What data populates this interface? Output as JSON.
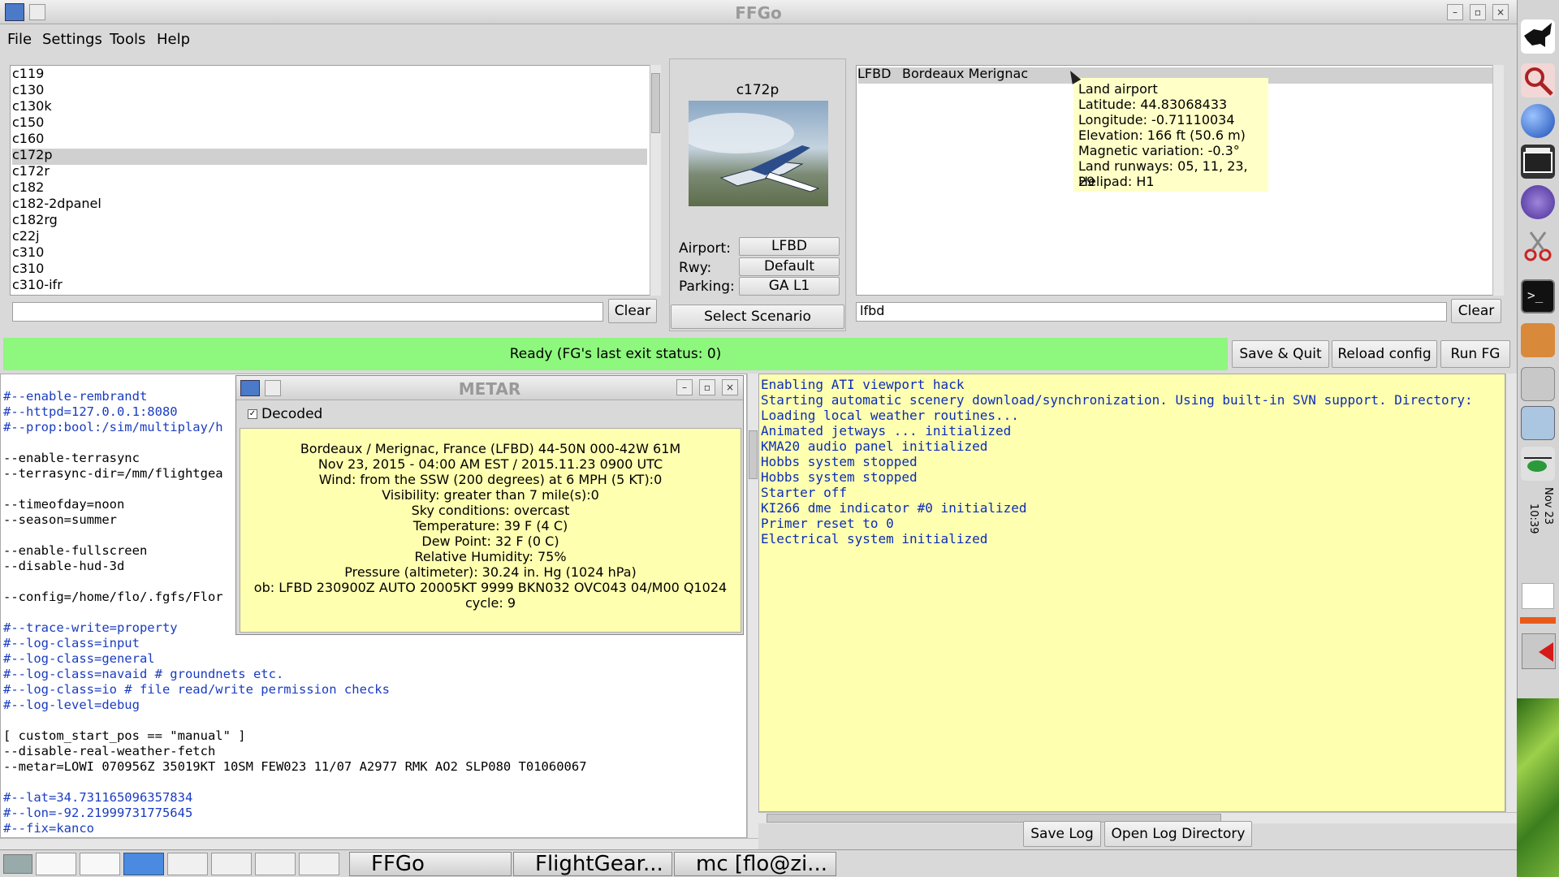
{
  "window": {
    "title": "FFGo"
  },
  "menu": [
    "File",
    "Settings",
    "Tools",
    "Help"
  ],
  "aircraft_list": {
    "items": [
      "c119",
      "c130",
      "c130k",
      "c150",
      "c160",
      "c172p",
      "c172r",
      "c182",
      "c182-2dpanel",
      "c182rg",
      "c22j",
      "c310",
      "c310",
      "c310-ifr"
    ],
    "selected": "c172p",
    "filter_value": "",
    "clear_label": "Clear"
  },
  "aircraft_info": {
    "name": "c172p",
    "airport_label": "Airport:",
    "airport_value": "LFBD",
    "rwy_label": "Rwy:",
    "rwy_value": "Default",
    "parking_label": "Parking:",
    "parking_value": "GA L1",
    "scenario_button": "Select Scenario"
  },
  "airport_list": {
    "items": [
      {
        "icao": "LFBD",
        "name": "Bordeaux Merignac"
      }
    ],
    "filter_value": "lfbd",
    "clear_label": "Clear"
  },
  "tooltip": {
    "lines": [
      "Land airport",
      "Latitude: 44.83068433",
      "Longitude: -0.71110034",
      "Elevation: 166 ft (50.6 m)",
      "Magnetic variation: -0.3°",
      "Land runways: 05, 11, 23, 29",
      "Helipad: H1"
    ]
  },
  "status": {
    "text": "Ready (FG's last exit status: 0)",
    "color": "#8ef77e"
  },
  "actions": {
    "save_quit": "Save & Quit",
    "reload_config": "Reload config",
    "run_fg": "Run FG"
  },
  "config_lines": [
    {
      "t": "#--enable-rembrandt",
      "c": "blue"
    },
    {
      "t": "#--httpd=127.0.0.1:8080",
      "c": "blue"
    },
    {
      "t": "#--prop:bool:/sim/multiplay/h",
      "c": "blue"
    },
    {
      "t": "",
      "c": ""
    },
    {
      "t": "--enable-terrasync",
      "c": ""
    },
    {
      "t": "--terrasync-dir=/mm/flightgea",
      "c": ""
    },
    {
      "t": "",
      "c": ""
    },
    {
      "t": "--timeofday=noon",
      "c": ""
    },
    {
      "t": "--season=summer",
      "c": ""
    },
    {
      "t": "",
      "c": ""
    },
    {
      "t": "--enable-fullscreen",
      "c": ""
    },
    {
      "t": "--disable-hud-3d",
      "c": ""
    },
    {
      "t": "",
      "c": ""
    },
    {
      "t": "--config=/home/flo/.fgfs/Flor",
      "c": ""
    },
    {
      "t": "",
      "c": ""
    },
    {
      "t": "#--trace-write=property",
      "c": "blue"
    },
    {
      "t": "#--log-class=input",
      "c": "blue"
    },
    {
      "t": "#--log-class=general",
      "c": "blue"
    },
    {
      "t": "#--log-class=navaid # groundnets etc.",
      "c": "blue"
    },
    {
      "t": "#--log-class=io # file read/write permission checks",
      "c": "blue"
    },
    {
      "t": "#--log-level=debug",
      "c": "blue"
    },
    {
      "t": "",
      "c": ""
    },
    {
      "t": "[ custom_start_pos == \"manual\" ]",
      "c": ""
    },
    {
      "t": "--disable-real-weather-fetch",
      "c": ""
    },
    {
      "t": "--metar=LOWI 070956Z 35019KT 10SM FEW023 11/07 A2977 RMK AO2 SLP080 T01060067",
      "c": ""
    },
    {
      "t": "",
      "c": ""
    },
    {
      "t": "#--lat=34.731165096357834",
      "c": "blue"
    },
    {
      "t": "#--lon=-92.21999731775645",
      "c": "blue"
    },
    {
      "t": "#--fix=kanco",
      "c": "blue"
    }
  ],
  "log_lines": [
    "Enabling ATI viewport hack",
    "Starting automatic scenery download/synchronization. Using built-in SVN support. Directory:",
    "Loading local weather routines...",
    "Animated jetways ... initialized",
    "KMA20 audio panel initialized",
    "Hobbs system stopped",
    "Hobbs system stopped",
    "Starter off",
    "KI266 dme indicator #0 initialized",
    "Primer reset to 0",
    "Electrical system initialized"
  ],
  "log_buttons": {
    "save_log": "Save Log",
    "open_dir": "Open Log Directory"
  },
  "metar": {
    "title": "METAR",
    "decoded_label": "Decoded",
    "decoded_checked": true,
    "lines": [
      "Bordeaux / Merignac, France (LFBD) 44-50N 000-42W 61M",
      "Nov 23, 2015 - 04:00 AM EST / 2015.11.23 0900 UTC",
      "Wind: from the SSW (200 degrees) at 6 MPH (5 KT):0",
      "Visibility: greater than 7 mile(s):0",
      "Sky conditions: overcast",
      "Temperature: 39 F (4 C)",
      "Dew Point: 32 F (0 C)",
      "Relative Humidity: 75%",
      "Pressure (altimeter): 30.24 in. Hg (1024 hPa)",
      "ob: LFBD 230900Z AUTO 20005KT 9999 BKN032 OVC043 04/M00 Q1024",
      "cycle: 9"
    ]
  },
  "taskbar": {
    "items": [
      "FFGo",
      "FlightGear...",
      "mc [flo@zi..."
    ]
  },
  "clock": {
    "time": "10:39",
    "date": "Nov 23"
  }
}
